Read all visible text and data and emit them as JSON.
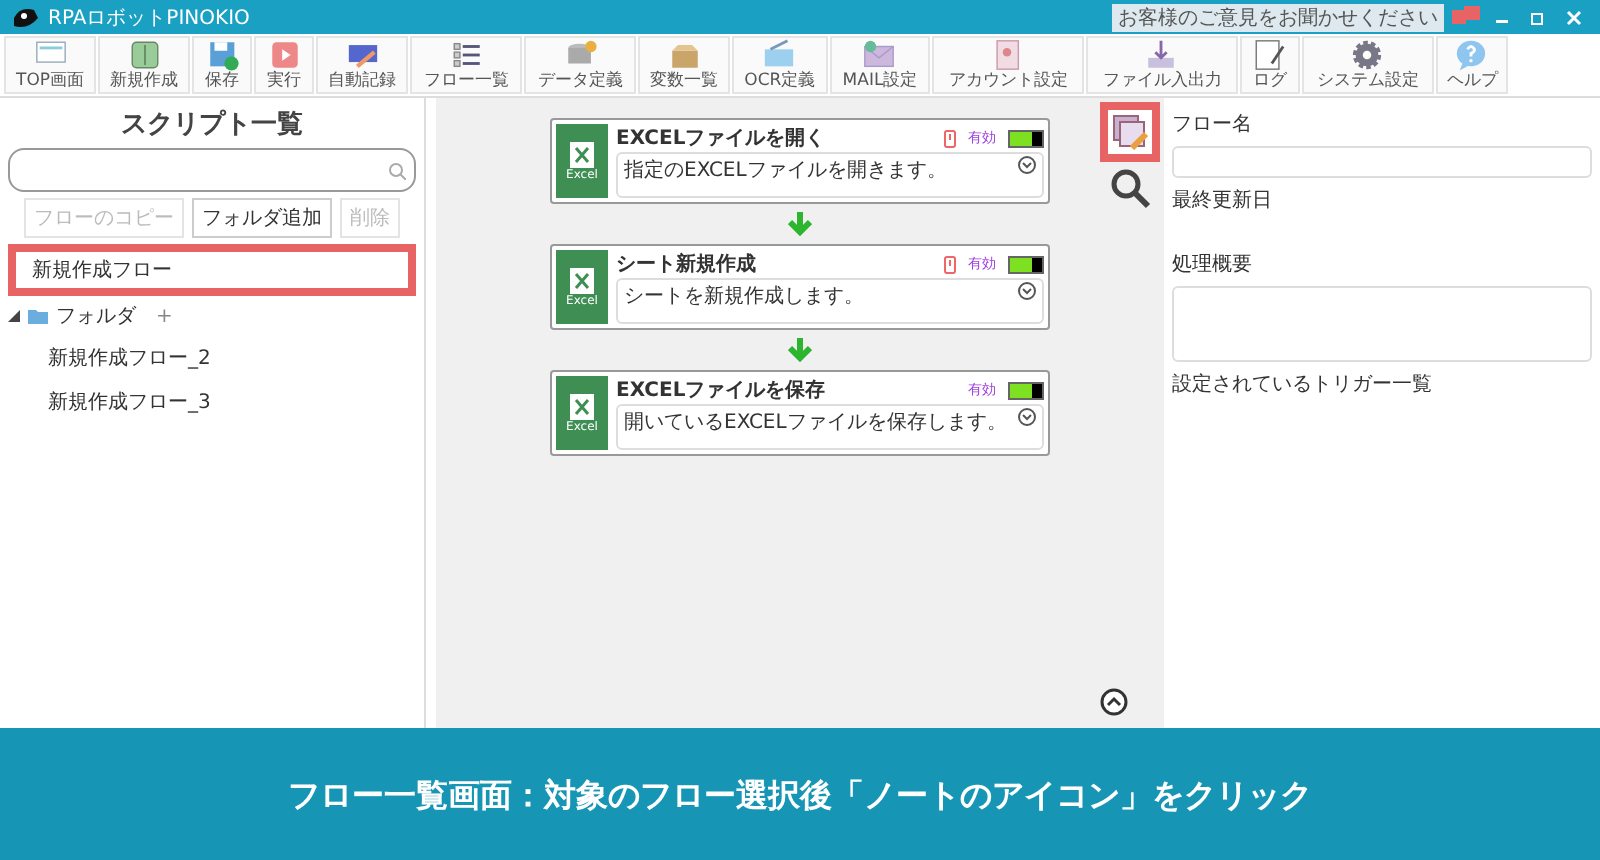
{
  "window": {
    "title": "RPAロボットPINOKIO",
    "feedback": "お客様のご意見をお聞かせください"
  },
  "toolbar": [
    {
      "label": "TOP画面"
    },
    {
      "label": "新規作成"
    },
    {
      "label": "保存"
    },
    {
      "label": "実行"
    },
    {
      "label": "自動記録"
    },
    {
      "label": "フロー一覧"
    },
    {
      "label": "データ定義"
    },
    {
      "label": "変数一覧"
    },
    {
      "label": "OCR定義"
    },
    {
      "label": "MAIL設定"
    },
    {
      "label": "アカウント設定"
    },
    {
      "label": "ファイル入出力"
    },
    {
      "label": "ログ"
    },
    {
      "label": "システム設定"
    },
    {
      "label": "ヘルプ"
    }
  ],
  "sidebar": {
    "title": "スクリプト一覧",
    "buttons": [
      {
        "label": "フローのコピー",
        "disabled": true
      },
      {
        "label": "フォルダ追加",
        "disabled": false
      },
      {
        "label": "削除",
        "disabled": true
      }
    ],
    "items": [
      {
        "label": "新規作成フロー",
        "kind": "flow",
        "selected": true
      },
      {
        "label": "フォルダ",
        "kind": "folder",
        "expanded": true,
        "add": "+",
        "children": [
          {
            "label": "新規作成フロー_2",
            "kind": "flow",
            "selected": false
          },
          {
            "label": "新規作成フロー_3",
            "kind": "flow",
            "selected": false
          }
        ]
      }
    ]
  },
  "steps": [
    {
      "title": "EXCELファイルを開く",
      "description": "指定のEXCELファイルを開きます。",
      "icon_label": "Excel",
      "warning": true,
      "status": "有効",
      "enabled": true
    },
    {
      "title": "シート新規作成",
      "description": "シートを新規作成します。",
      "icon_label": "Excel",
      "warning": true,
      "status": "有効",
      "enabled": true
    },
    {
      "title": "EXCELファイルを保存",
      "description": "開いているEXCELファイルを保存します。",
      "icon_label": "Excel",
      "warning": false,
      "status": "有効",
      "enabled": true
    }
  ],
  "note_button": {
    "highlighted": true
  },
  "details": {
    "fields": [
      {
        "label": "フロー名",
        "kind": "input"
      },
      {
        "label": "最終更新日",
        "kind": "text"
      },
      {
        "label": "処理概要",
        "kind": "textarea"
      },
      {
        "label": "設定されているトリガー一覧",
        "kind": "text"
      }
    ]
  },
  "caption": "フロー一覧画面：対象のフロー選択後「ノートのアイコン」をクリック"
}
